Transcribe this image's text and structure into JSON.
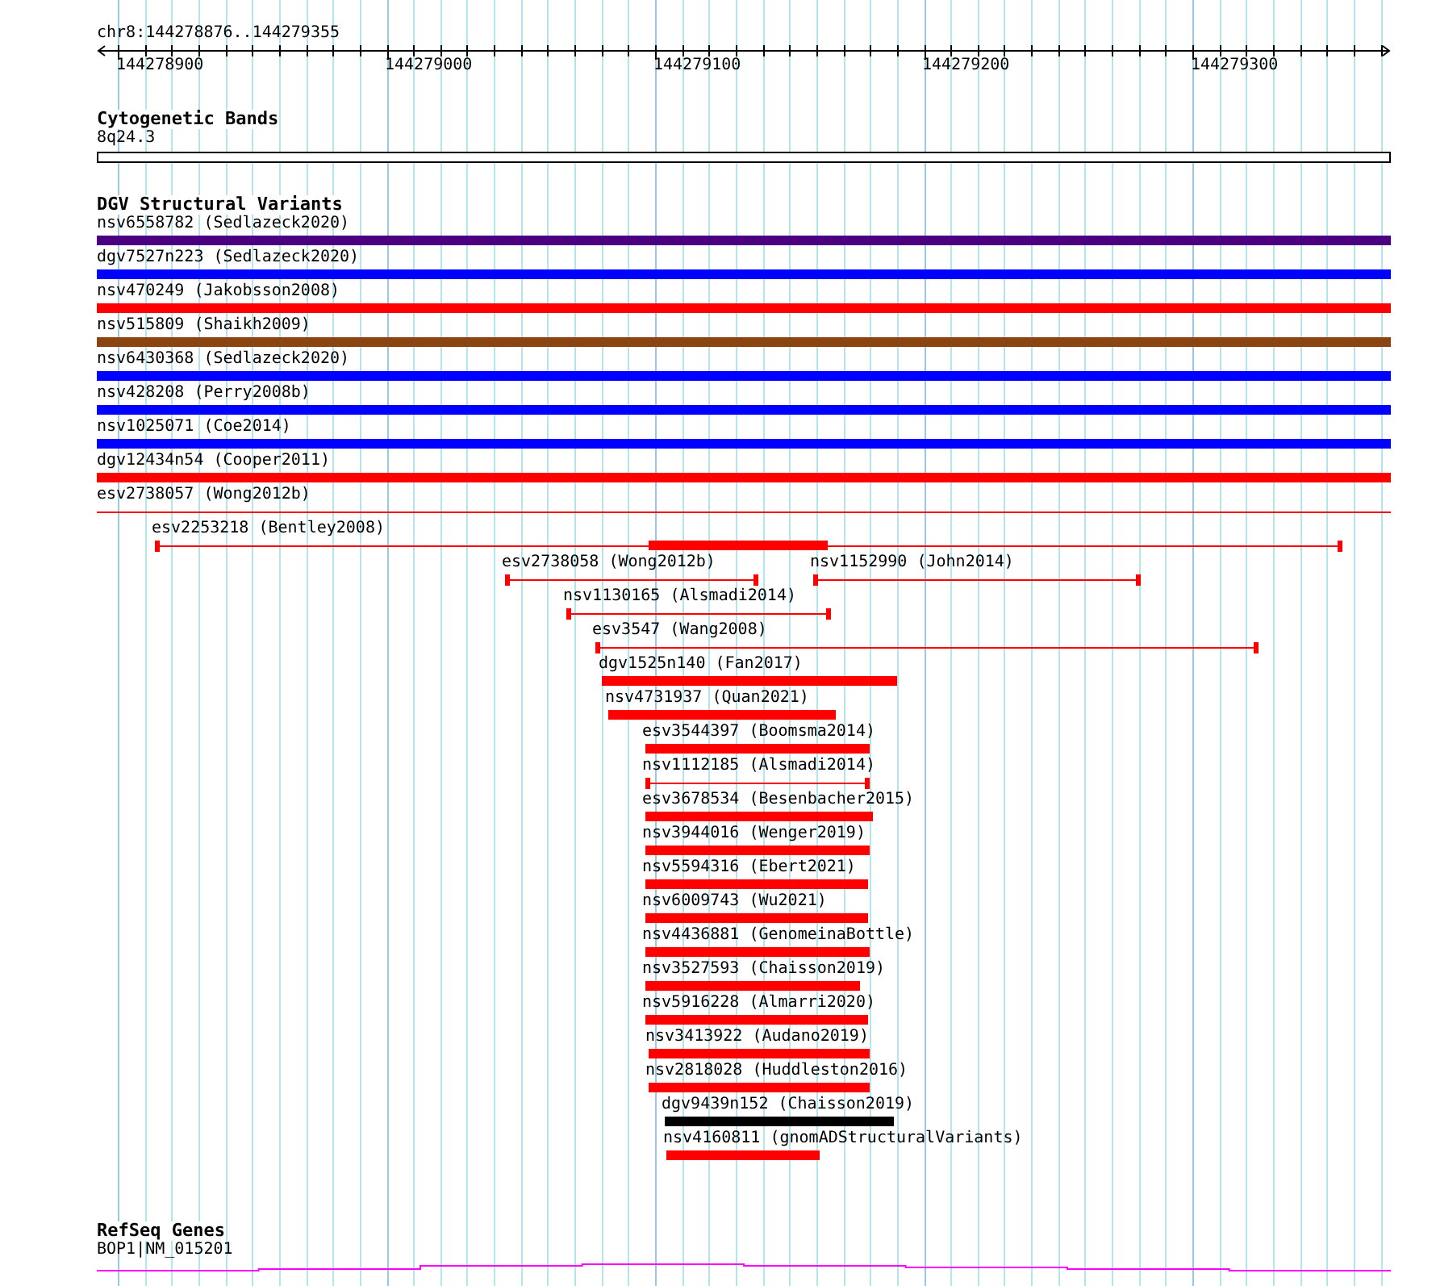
{
  "ruler": {
    "location": "chr8:144278876..144279355",
    "ticks": [
      "144278900",
      "144279000",
      "144279100",
      "144279200",
      "144279300"
    ]
  },
  "cytogenetic_bands": {
    "title": "Cytogenetic Bands",
    "bands": [
      {
        "label": "8q24.3"
      }
    ]
  },
  "dgv": {
    "title": "DGV Structural Variants",
    "rows": [
      {
        "features": [
          {
            "label": "nsv6558782 (Sedlazeck2020)",
            "kind": "bar",
            "color": "#4b0082"
          }
        ]
      },
      {
        "features": [
          {
            "label": "dgv7527n223 (Sedlazeck2020)",
            "kind": "bar",
            "color": "#0000ff"
          }
        ]
      },
      {
        "features": [
          {
            "label": "nsv470249 (Jakobsson2008)",
            "kind": "bar",
            "color": "#ff0000"
          }
        ]
      },
      {
        "features": [
          {
            "label": "nsv515809 (Shaikh2009)",
            "kind": "bar",
            "color": "#8b4513"
          }
        ]
      },
      {
        "features": [
          {
            "label": "nsv6430368 (Sedlazeck2020)",
            "kind": "bar",
            "color": "#0000ff"
          }
        ]
      },
      {
        "features": [
          {
            "label": "nsv428208 (Perry2008b)",
            "kind": "bar",
            "color": "#0000ff"
          }
        ]
      },
      {
        "features": [
          {
            "label": "nsv1025071 (Coe2014)",
            "kind": "bar",
            "color": "#0000ff"
          }
        ]
      },
      {
        "features": [
          {
            "label": "dgv12434n54 (Cooper2011)",
            "kind": "bar",
            "color": "#ff0000"
          }
        ]
      },
      {
        "features": [
          {
            "label": "esv2738057 (Wong2012b)",
            "kind": "line",
            "color": "#ff0000"
          }
        ]
      },
      {
        "features": [
          {
            "label": "esv2253218 (Bentley2008)",
            "kind": "line",
            "color": "#ff0000",
            "thick": true
          }
        ]
      },
      {
        "features": [
          {
            "label": "esv2738058 (Wong2012b)",
            "kind": "line",
            "color": "#ff0000"
          },
          {
            "label": "nsv1152990 (John2014)",
            "kind": "line",
            "color": "#ff0000"
          }
        ]
      },
      {
        "features": [
          {
            "label": "nsv1130165 (Alsmadi2014)",
            "kind": "line",
            "color": "#ff0000"
          }
        ]
      },
      {
        "features": [
          {
            "label": "esv3547 (Wang2008)",
            "kind": "line",
            "color": "#ff0000"
          }
        ]
      },
      {
        "features": [
          {
            "label": "dgv1525n140 (Fan2017)",
            "kind": "bar",
            "color": "#ff0000"
          }
        ]
      },
      {
        "features": [
          {
            "label": "nsv4731937 (Quan2021)",
            "kind": "bar",
            "color": "#ff0000"
          }
        ]
      },
      {
        "features": [
          {
            "label": "esv3544397 (Boomsma2014)",
            "kind": "bar",
            "color": "#ff0000"
          }
        ]
      },
      {
        "features": [
          {
            "label": "nsv1112185 (Alsmadi2014)",
            "kind": "line",
            "color": "#ff0000"
          }
        ]
      },
      {
        "features": [
          {
            "label": "esv3678534 (Besenbacher2015)",
            "kind": "bar",
            "color": "#ff0000"
          }
        ]
      },
      {
        "features": [
          {
            "label": "nsv3944016 (Wenger2019)",
            "kind": "bar",
            "color": "#ff0000"
          }
        ]
      },
      {
        "features": [
          {
            "label": "nsv5594316 (Ebert2021)",
            "kind": "bar",
            "color": "#ff0000"
          }
        ]
      },
      {
        "features": [
          {
            "label": "nsv6009743 (Wu2021)",
            "kind": "bar",
            "color": "#ff0000"
          }
        ]
      },
      {
        "features": [
          {
            "label": "nsv4436881 (GenomeinaBottle)",
            "kind": "bar",
            "color": "#ff0000"
          }
        ]
      },
      {
        "features": [
          {
            "label": "nsv3527593 (Chaisson2019)",
            "kind": "bar",
            "color": "#ff0000"
          }
        ]
      },
      {
        "features": [
          {
            "label": "nsv5916228 (Almarri2020)",
            "kind": "bar",
            "color": "#ff0000"
          }
        ]
      },
      {
        "features": [
          {
            "label": "nsv3413922 (Audano2019)",
            "kind": "bar",
            "color": "#ff0000"
          }
        ]
      },
      {
        "features": [
          {
            "label": "nsv2818028 (Huddleston2016)",
            "kind": "bar",
            "color": "#ff0000"
          }
        ]
      },
      {
        "features": [
          {
            "label": "dgv9439n152 (Chaisson2019)",
            "kind": "bar",
            "color": "#000000"
          }
        ]
      },
      {
        "features": [
          {
            "label": "nsv4160811 (gnomADStructuralVariants)",
            "kind": "bar",
            "color": "#ff0000"
          }
        ]
      }
    ]
  },
  "refseq_genes": {
    "title": "RefSeq Genes",
    "genes": [
      {
        "label": "BOP1|NM_015201"
      }
    ]
  }
}
